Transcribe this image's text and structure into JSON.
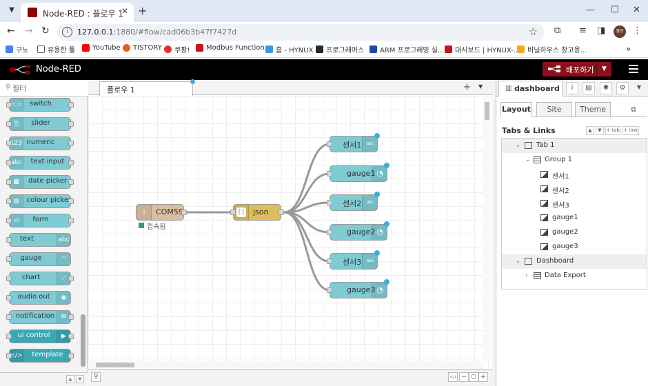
{
  "browser": {
    "tab_title": "Node-RED : 플로우 1",
    "url_host": "127.0.0.1",
    "url_path": ":1880/#flow/cad06b3b47f7427d",
    "avatar": "영규",
    "bookmarks": [
      {
        "label": "구노",
        "color": "#4285f4"
      },
      {
        "label": "유용한 툴",
        "color": "#555555"
      },
      {
        "label": "YouTube",
        "color": "#ff0000"
      },
      {
        "label": "TISTORY",
        "color": "#f15a22"
      },
      {
        "label": "쿠팡!",
        "color": "#e22e2e"
      },
      {
        "label": "Modbus Function...",
        "color": "#c4161c"
      },
      {
        "label": "홈 - HYNUX",
        "color": "#2fa0d8"
      },
      {
        "label": "프로그래머스",
        "color": "#1e2a3a"
      },
      {
        "label": "ARM 프로그래밍 실...",
        "color": "#1b4aa0"
      },
      {
        "label": "대시보드 | HYNUX-...",
        "color": "#c4161c"
      },
      {
        "label": "비닐하우스 창고용...",
        "color": "#f5a623"
      }
    ]
  },
  "app": {
    "title": "Node-RED",
    "deploy_label": "배포하기"
  },
  "palette": {
    "search_placeholder": "필터",
    "nodes": [
      {
        "label": "switch",
        "icon": "switch-icon"
      },
      {
        "label": "slider",
        "icon": "slider-icon"
      },
      {
        "label": "numeric",
        "icon": "numeric-icon"
      },
      {
        "label": "text input",
        "icon": "text-input-icon"
      },
      {
        "label": "date picker",
        "icon": "calendar-icon"
      },
      {
        "label": "colour picker",
        "icon": "palette-icon"
      },
      {
        "label": "form",
        "icon": "form-icon"
      },
      {
        "label": "text",
        "icon": "text-icon"
      },
      {
        "label": "gauge",
        "icon": "gauge-icon"
      },
      {
        "label": "chart",
        "icon": "chart-icon"
      },
      {
        "label": "audio out",
        "icon": "audio-icon"
      },
      {
        "label": "notification",
        "icon": "envelope-icon"
      },
      {
        "label": "ui control",
        "icon": "control-icon"
      },
      {
        "label": "template",
        "icon": "code-icon"
      }
    ]
  },
  "workspace": {
    "tab_label": "플로우 1",
    "nodes": {
      "serial": {
        "label": "COM59",
        "status": "접속됨",
        "color": "#d8bfa0"
      },
      "json": {
        "label": "json",
        "color": "#debd5c"
      },
      "outputs": [
        {
          "label": "센서1",
          "type": "text"
        },
        {
          "label": "gauge1",
          "type": "gauge"
        },
        {
          "label": "센서2",
          "type": "text"
        },
        {
          "label": "gauge2",
          "type": "gauge"
        },
        {
          "label": "센서3",
          "type": "text"
        },
        {
          "label": "gauge3",
          "type": "gauge"
        }
      ]
    }
  },
  "sidebar": {
    "tab_label": "dashboard",
    "db_tabs": [
      "Layout",
      "Site",
      "Theme"
    ],
    "tabs_links_title": "Tabs & Links",
    "tl_buttons": [
      "+ tab",
      "+ link"
    ],
    "tree": [
      {
        "label": "Tab 1",
        "level": 0,
        "kind": "tab"
      },
      {
        "label": "Group 1",
        "level": 1,
        "kind": "group"
      },
      {
        "label": "센서1",
        "level": 2,
        "kind": "widget"
      },
      {
        "label": "센서2",
        "level": 2,
        "kind": "widget"
      },
      {
        "label": "센서3",
        "level": 2,
        "kind": "widget"
      },
      {
        "label": "gauge1",
        "level": 2,
        "kind": "widget"
      },
      {
        "label": "gauge2",
        "level": 2,
        "kind": "widget"
      },
      {
        "label": "gauge3",
        "level": 2,
        "kind": "widget"
      },
      {
        "label": "Dashboard",
        "level": 0,
        "kind": "tab"
      },
      {
        "label": "Data Export",
        "level": 1,
        "kind": "group-collapsed"
      }
    ]
  },
  "colors": {
    "node_teal": "#7ecbd4",
    "node_teal_dark": "#3aa7b5",
    "deploy": "#8c101c",
    "dot_blue": "#3fadd7",
    "status_green": "#3d9b70"
  }
}
